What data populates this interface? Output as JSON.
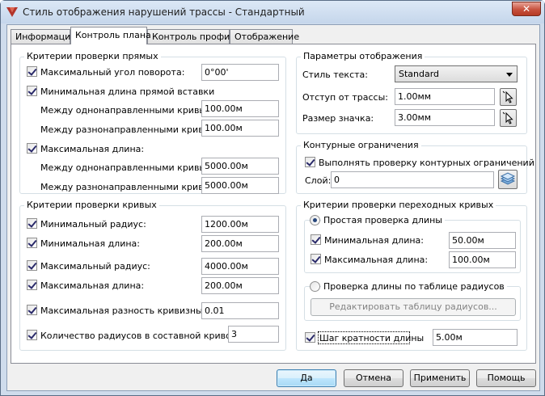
{
  "window": {
    "title": "Стиль отображения нарушений трассы - Стандартный",
    "close_symbol": "✕"
  },
  "tabs": [
    {
      "label": "Информация",
      "active": false
    },
    {
      "label": "Контроль плана",
      "active": true
    },
    {
      "label": "Контроль профиля",
      "active": false
    },
    {
      "label": "Отображение",
      "active": false
    }
  ],
  "tangent_criteria": {
    "title": "Критерии проверки прямых",
    "max_angle": {
      "label": "Максимальный угол поворота:",
      "checked": true,
      "value": "0°00'"
    },
    "min_tangent": {
      "label": "Минимальная длина прямой вставки",
      "checked": true,
      "same_dir_label": "Между однонаправленными кривыми:",
      "same_dir_value": "100.00м",
      "opp_dir_label": "Между разнонаправленными кривыми:",
      "opp_dir_value": "100.00м"
    },
    "max_length": {
      "label": "Максимальная длина:",
      "checked": true,
      "same_dir_label": "Между однонаправленными кривыми:",
      "same_dir_value": "5000.00м",
      "opp_dir_label": "Между разнонаправленными кривыми:",
      "opp_dir_value": "5000.00м"
    }
  },
  "curve_criteria": {
    "title": "Критерии проверки кривых",
    "min_radius": {
      "label": "Минимальный радиус:",
      "checked": true,
      "value": "1200.00м"
    },
    "min_length": {
      "label": "Минимальная длина:",
      "checked": true,
      "value": "200.00м"
    },
    "max_radius": {
      "label": "Максимальный радиус:",
      "checked": true,
      "value": "4000.00м"
    },
    "max_length": {
      "label": "Максимальная длина:",
      "checked": true,
      "value": "200.00м"
    },
    "max_curvature_diff": {
      "label": "Максимальная разность кривизны:",
      "checked": true,
      "value": "0.01"
    },
    "compound_count": {
      "label": "Количество радиусов в составной кривой:",
      "checked": true,
      "value": "3"
    }
  },
  "display_params": {
    "title": "Параметры отображения",
    "text_style_label": "Стиль текста:",
    "text_style_value": "Standard",
    "offset_label": "Отступ от трассы:",
    "offset_value": "1.00мм",
    "marker_size_label": "Размер значка:",
    "marker_size_value": "3.00мм"
  },
  "contour": {
    "title": "Контурные ограничения",
    "check_label": "Выполнять проверку контурных ограничений",
    "checked": true,
    "layer_label": "Слой:",
    "layer_value": "0"
  },
  "transition": {
    "title": "Критерии проверки переходных кривых",
    "simple_label": "Простая проверка длины",
    "simple_selected": true,
    "min_length": {
      "label": "Минимальная длина:",
      "checked": true,
      "value": "50.00м"
    },
    "max_length": {
      "label": "Максимальная длина:",
      "checked": true,
      "value": "100.00м"
    },
    "table_label": "Проверка длины по таблице радиусов",
    "table_selected": false,
    "edit_table_label": "Редактировать таблицу радиусов...",
    "step_label": "Шаг кратности длины",
    "step_checked": true,
    "step_value": "5.00м"
  },
  "buttons": {
    "ok": "Да",
    "cancel": "Отмена",
    "apply": "Применить",
    "help": "Помощь"
  },
  "colors": {
    "title_bg": "#c5d6eb",
    "close_bg": "#c7513d",
    "default_button": "#bee6fd"
  }
}
